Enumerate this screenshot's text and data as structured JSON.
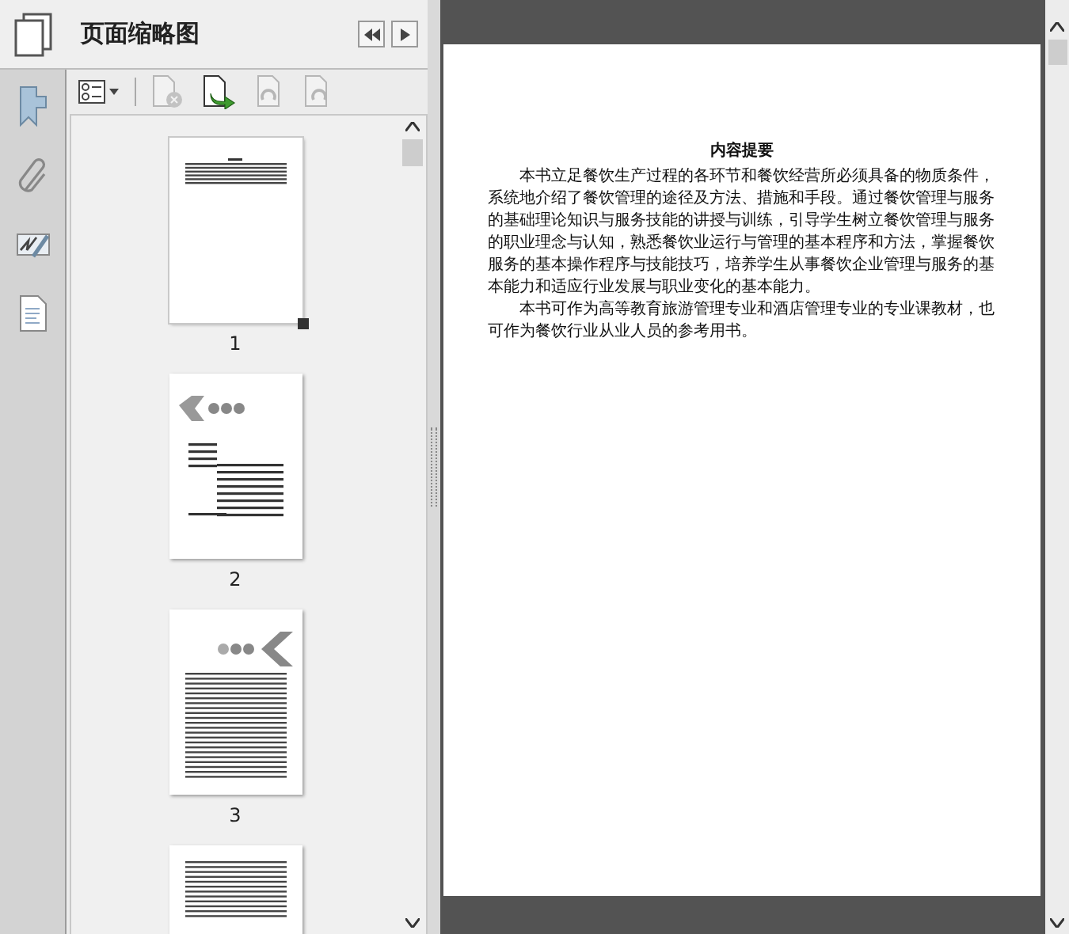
{
  "panel": {
    "title": "页面缩略图",
    "tools": [
      {
        "kind": "options",
        "disabled": false
      },
      {
        "kind": "delete",
        "disabled": true
      },
      {
        "kind": "insert",
        "disabled": false
      },
      {
        "kind": "undo",
        "disabled": true
      },
      {
        "kind": "redo",
        "disabled": true
      }
    ],
    "thumbnails": [
      {
        "kind": "summary",
        "label": "1",
        "selected": true
      },
      {
        "kind": "cover",
        "label": "2",
        "selected": false
      },
      {
        "kind": "chapter",
        "label": "3",
        "selected": false
      },
      {
        "kind": "text",
        "selected": false
      }
    ]
  },
  "document": {
    "heading": "内容提要",
    "paragraphs": [
      "本书立足餐饮生产过程的各环节和餐饮经营所必须具备的物质条件，系统地介绍了餐饮管理的途径及方法、措施和手段。通过餐饮管理与服务的基础理论知识与服务技能的讲授与训练，引导学生树立餐饮管理与服务的职业理念与认知，熟悉餐饮业运行与管理的基本程序和方法，掌握餐饮服务的基本操作程序与技能技巧，培养学生从事餐饮企业管理与服务的基本能力和适应行业发展与职业变化的基本能力。",
      "本书可作为高等教育旅游管理专业和酒店管理专业的专业课教材，也可作为餐饮行业从业人员的参考用书。"
    ]
  }
}
